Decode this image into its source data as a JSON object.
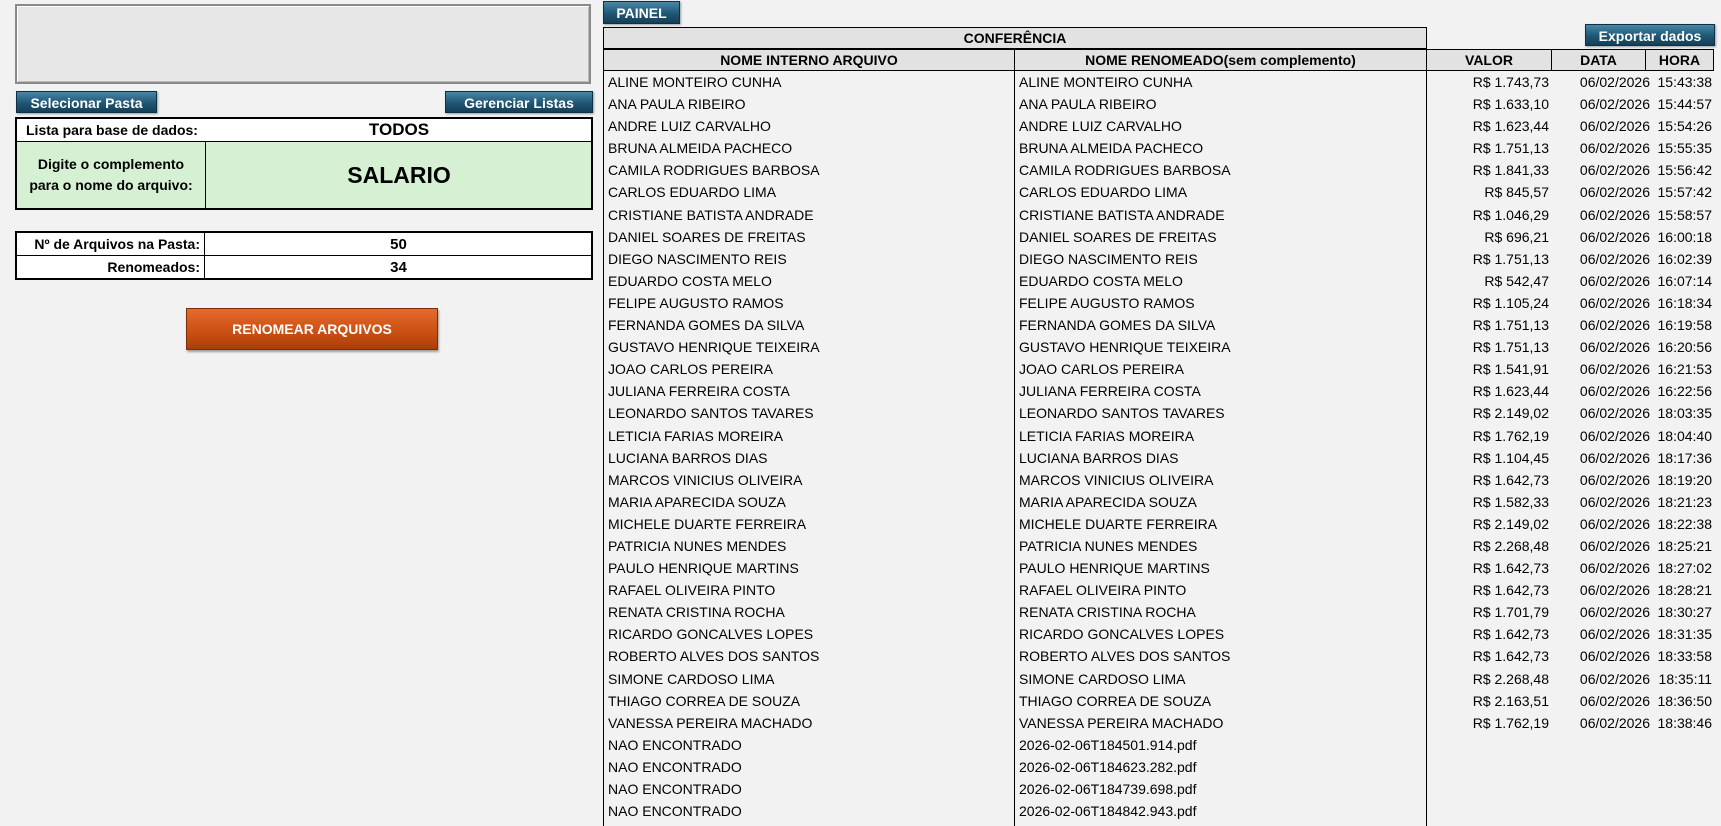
{
  "painel_label": "PAINEL",
  "export_label": "Exportar dados",
  "left": {
    "select_folder_label": "Selecionar Pasta",
    "manage_lists_label": "Gerenciar Listas",
    "db_list_label": "Lista para base de dados:",
    "db_list_value": "TODOS",
    "complement_label_1": "Digite o complemento",
    "complement_label_2": "para o nome do arquivo:",
    "complement_value": "SALARIO",
    "files_count_label": "Nº de Arquivos na Pasta:",
    "files_count_value": "50",
    "renamed_label": "Renomeados:",
    "renamed_value": "34",
    "rename_button_label": "RENOMEAR ARQUIVOS"
  },
  "table": {
    "group_header": "CONFERÊNCIA",
    "headers": {
      "internal": "NOME INTERNO ARQUIVO",
      "renamed": "NOME RENOMEADO(sem complemento)",
      "value": "VALOR",
      "date": "DATA",
      "time": "HORA"
    },
    "rows": [
      {
        "internal": "ALINE MONTEIRO CUNHA",
        "renamed": "ALINE MONTEIRO CUNHA",
        "value": "R$ 1.743,73",
        "date": "06/02/2026",
        "time": "15:43:38"
      },
      {
        "internal": "ANA PAULA RIBEIRO",
        "renamed": "ANA PAULA RIBEIRO",
        "value": "R$ 1.633,10",
        "date": "06/02/2026",
        "time": "15:44:57"
      },
      {
        "internal": "ANDRE LUIZ CARVALHO",
        "renamed": "ANDRE LUIZ CARVALHO",
        "value": "R$ 1.623,44",
        "date": "06/02/2026",
        "time": "15:54:26"
      },
      {
        "internal": "BRUNA ALMEIDA PACHECO",
        "renamed": "BRUNA ALMEIDA PACHECO",
        "value": "R$ 1.751,13",
        "date": "06/02/2026",
        "time": "15:55:35"
      },
      {
        "internal": "CAMILA RODRIGUES BARBOSA",
        "renamed": "CAMILA RODRIGUES BARBOSA",
        "value": "R$ 1.841,33",
        "date": "06/02/2026",
        "time": "15:56:42"
      },
      {
        "internal": "CARLOS EDUARDO LIMA",
        "renamed": "CARLOS EDUARDO LIMA",
        "value": "R$ 845,57",
        "date": "06/02/2026",
        "time": "15:57:42"
      },
      {
        "internal": "CRISTIANE BATISTA ANDRADE",
        "renamed": "CRISTIANE BATISTA ANDRADE",
        "value": "R$ 1.046,29",
        "date": "06/02/2026",
        "time": "15:58:57"
      },
      {
        "internal": "DANIEL SOARES DE FREITAS",
        "renamed": "DANIEL SOARES DE FREITAS",
        "value": "R$ 696,21",
        "date": "06/02/2026",
        "time": "16:00:18"
      },
      {
        "internal": "DIEGO NASCIMENTO REIS",
        "renamed": "DIEGO NASCIMENTO REIS",
        "value": "R$ 1.751,13",
        "date": "06/02/2026",
        "time": "16:02:39"
      },
      {
        "internal": "EDUARDO COSTA MELO",
        "renamed": "EDUARDO COSTA MELO",
        "value": "R$ 542,47",
        "date": "06/02/2026",
        "time": "16:07:14"
      },
      {
        "internal": "FELIPE AUGUSTO RAMOS",
        "renamed": "FELIPE AUGUSTO RAMOS",
        "value": "R$ 1.105,24",
        "date": "06/02/2026",
        "time": "16:18:34"
      },
      {
        "internal": "FERNANDA GOMES DA SILVA",
        "renamed": "FERNANDA GOMES DA SILVA",
        "value": "R$ 1.751,13",
        "date": "06/02/2026",
        "time": "16:19:58"
      },
      {
        "internal": "GUSTAVO HENRIQUE TEIXEIRA",
        "renamed": "GUSTAVO HENRIQUE TEIXEIRA",
        "value": "R$ 1.751,13",
        "date": "06/02/2026",
        "time": "16:20:56"
      },
      {
        "internal": "JOAO CARLOS PEREIRA",
        "renamed": "JOAO CARLOS PEREIRA",
        "value": "R$ 1.541,91",
        "date": "06/02/2026",
        "time": "16:21:53"
      },
      {
        "internal": "JULIANA FERREIRA COSTA",
        "renamed": "JULIANA FERREIRA COSTA",
        "value": "R$ 1.623,44",
        "date": "06/02/2026",
        "time": "16:22:56"
      },
      {
        "internal": "LEONARDO SANTOS TAVARES",
        "renamed": "LEONARDO SANTOS TAVARES",
        "value": "R$ 2.149,02",
        "date": "06/02/2026",
        "time": "18:03:35"
      },
      {
        "internal": "LETICIA FARIAS MOREIRA",
        "renamed": "LETICIA FARIAS MOREIRA",
        "value": "R$ 1.762,19",
        "date": "06/02/2026",
        "time": "18:04:40"
      },
      {
        "internal": "LUCIANA BARROS DIAS",
        "renamed": "LUCIANA BARROS DIAS",
        "value": "R$ 1.104,45",
        "date": "06/02/2026",
        "time": "18:17:36"
      },
      {
        "internal": "MARCOS VINICIUS OLIVEIRA",
        "renamed": "MARCOS VINICIUS OLIVEIRA",
        "value": "R$ 1.642,73",
        "date": "06/02/2026",
        "time": "18:19:20"
      },
      {
        "internal": "MARIA APARECIDA SOUZA",
        "renamed": "MARIA APARECIDA SOUZA",
        "value": "R$ 1.582,33",
        "date": "06/02/2026",
        "time": "18:21:23"
      },
      {
        "internal": "MICHELE DUARTE FERREIRA",
        "renamed": "MICHELE DUARTE FERREIRA",
        "value": "R$ 2.149,02",
        "date": "06/02/2026",
        "time": "18:22:38"
      },
      {
        "internal": "PATRICIA NUNES MENDES",
        "renamed": "PATRICIA NUNES MENDES",
        "value": "R$ 2.268,48",
        "date": "06/02/2026",
        "time": "18:25:21"
      },
      {
        "internal": "PAULO HENRIQUE MARTINS",
        "renamed": "PAULO HENRIQUE MARTINS",
        "value": "R$ 1.642,73",
        "date": "06/02/2026",
        "time": "18:27:02"
      },
      {
        "internal": "RAFAEL OLIVEIRA PINTO",
        "renamed": "RAFAEL OLIVEIRA PINTO",
        "value": "R$ 1.642,73",
        "date": "06/02/2026",
        "time": "18:28:21"
      },
      {
        "internal": "RENATA CRISTINA ROCHA",
        "renamed": "RENATA CRISTINA ROCHA",
        "value": "R$ 1.701,79",
        "date": "06/02/2026",
        "time": "18:30:27"
      },
      {
        "internal": "RICARDO GONCALVES LOPES",
        "renamed": "RICARDO GONCALVES LOPES",
        "value": "R$ 1.642,73",
        "date": "06/02/2026",
        "time": "18:31:35"
      },
      {
        "internal": "ROBERTO ALVES DOS SANTOS",
        "renamed": "ROBERTO ALVES DOS SANTOS",
        "value": "R$ 1.642,73",
        "date": "06/02/2026",
        "time": "18:33:58"
      },
      {
        "internal": "SIMONE CARDOSO LIMA",
        "renamed": "SIMONE CARDOSO LIMA",
        "value": "R$ 2.268,48",
        "date": "06/02/2026",
        "time": "18:35:11"
      },
      {
        "internal": "THIAGO CORREA DE SOUZA",
        "renamed": "THIAGO CORREA DE SOUZA",
        "value": "R$ 2.163,51",
        "date": "06/02/2026",
        "time": "18:36:50"
      },
      {
        "internal": "VANESSA PEREIRA MACHADO",
        "renamed": "VANESSA PEREIRA MACHADO",
        "value": "R$ 1.762,19",
        "date": "06/02/2026",
        "time": "18:38:46"
      },
      {
        "internal": "NAO ENCONTRADO",
        "renamed": "2026-02-06T184501.914.pdf",
        "value": "",
        "date": "",
        "time": ""
      },
      {
        "internal": "NAO ENCONTRADO",
        "renamed": "2026-02-06T184623.282.pdf",
        "value": "",
        "date": "",
        "time": ""
      },
      {
        "internal": "NAO ENCONTRADO",
        "renamed": "2026-02-06T184739.698.pdf",
        "value": "",
        "date": "",
        "time": ""
      },
      {
        "internal": "NAO ENCONTRADO",
        "renamed": "2026-02-06T184842.943.pdf",
        "value": "",
        "date": "",
        "time": ""
      }
    ]
  }
}
